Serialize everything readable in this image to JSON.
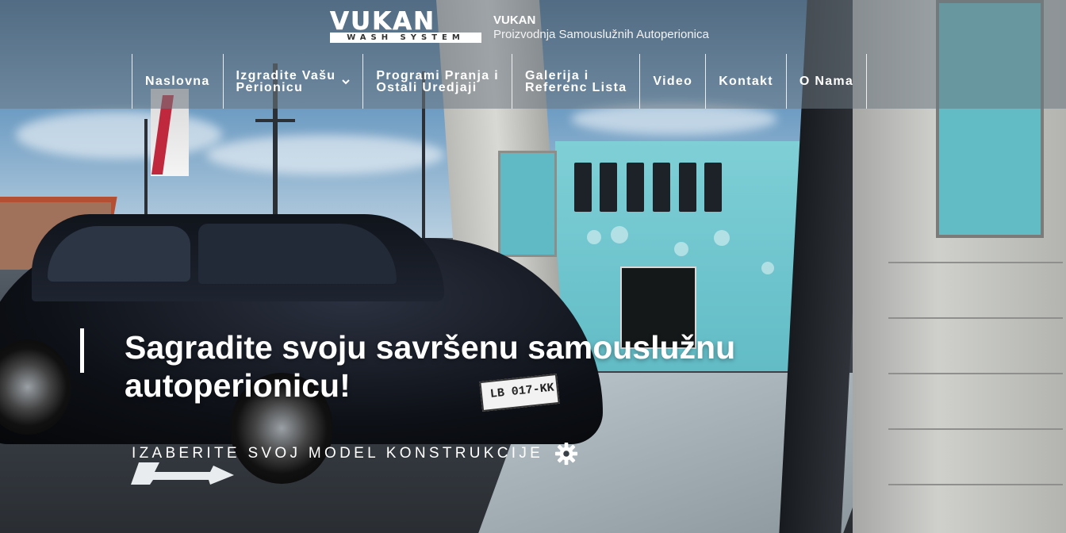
{
  "header": {
    "logo": {
      "word": "VUKAN",
      "sub": "WASH SYSTEM"
    },
    "site_title": "VUKAN",
    "tagline": "Proizvodnja Samouslužnih Autoperionica"
  },
  "nav": {
    "items": [
      {
        "label": "Naslovna"
      },
      {
        "label": "Izgradite Vašu\nPerionicu",
        "has_dropdown": true
      },
      {
        "label": "Programi Pranja i\nOstali Uredjaji"
      },
      {
        "label": "Galerija i\nReferenc Lista"
      },
      {
        "label": "Video"
      },
      {
        "label": "Kontakt"
      },
      {
        "label": "O Nama"
      }
    ]
  },
  "hero": {
    "heading_line1": "Sagradite svoju savršenu samouslužnu",
    "heading_line2": "autoperionicu!",
    "cta_label": "IZABERITE SVOJ MODEL KONSTRUKCIJE",
    "cta_icon": "gear-icon"
  },
  "photo": {
    "license_plate": "LB 017-KK"
  },
  "colors": {
    "header_overlay": "#6e7882",
    "text": "#ffffff",
    "accent_panel": "#62bcc6"
  }
}
